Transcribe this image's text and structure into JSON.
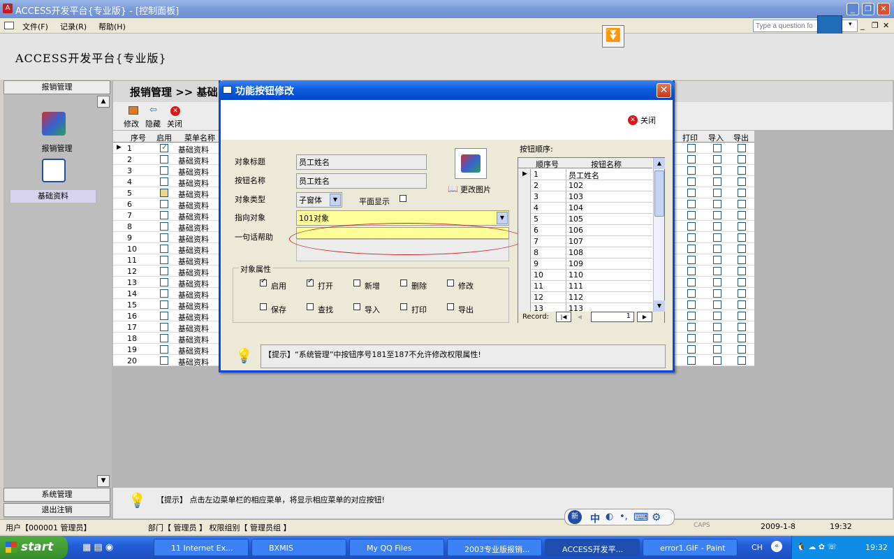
{
  "window": {
    "title": "ACCESS开发平台{专业版} - [控制面板]",
    "question_placeholder": "Type a question fo"
  },
  "menu": [
    "文件(F)",
    "记录(R)",
    "帮助(H)"
  ],
  "app_title": "ACCESS开发平台{专业版}",
  "sidebar": {
    "top_header": "报销管理",
    "items": [
      {
        "label": "报销管理",
        "icon": "cube-icon"
      },
      {
        "label": "基础资料",
        "icon": "dots-icon"
      }
    ],
    "bottom_items": [
      "系统管理",
      "退出注销"
    ]
  },
  "main": {
    "breadcrumb": "报销管理 >> 基础",
    "toolbar": [
      "修改",
      "隐藏",
      "关闭"
    ],
    "columns": [
      "序号",
      "启用",
      "菜单名称"
    ],
    "right_columns": [
      "打印",
      "导入",
      "导出"
    ],
    "rows": [
      {
        "no": "1",
        "enabled": true,
        "name": "基础资料"
      },
      {
        "no": "2",
        "enabled": false,
        "name": "基础资料"
      },
      {
        "no": "3",
        "enabled": false,
        "name": "基础资料"
      },
      {
        "no": "4",
        "enabled": false,
        "name": "基础资料"
      },
      {
        "no": "5",
        "enabled": false,
        "name": "基础资料"
      },
      {
        "no": "6",
        "enabled": false,
        "name": "基础资料"
      },
      {
        "no": "7",
        "enabled": false,
        "name": "基础资料"
      },
      {
        "no": "8",
        "enabled": false,
        "name": "基础资料"
      },
      {
        "no": "9",
        "enabled": false,
        "name": "基础资料"
      },
      {
        "no": "10",
        "enabled": false,
        "name": "基础资料"
      },
      {
        "no": "11",
        "enabled": false,
        "name": "基础资料"
      },
      {
        "no": "12",
        "enabled": false,
        "name": "基础资料"
      },
      {
        "no": "13",
        "enabled": false,
        "name": "基础资料"
      },
      {
        "no": "14",
        "enabled": false,
        "name": "基础资料"
      },
      {
        "no": "15",
        "enabled": false,
        "name": "基础资料"
      },
      {
        "no": "16",
        "enabled": false,
        "name": "基础资料"
      },
      {
        "no": "17",
        "enabled": false,
        "name": "基础资料"
      },
      {
        "no": "18",
        "enabled": false,
        "name": "基础资料"
      },
      {
        "no": "19",
        "enabled": false,
        "name": "基础资料"
      },
      {
        "no": "20",
        "enabled": false,
        "name": "基础资料"
      }
    ],
    "tip": "【提示】 点击左边菜单栏的相应菜单，将显示相应菜单的对应按钮!"
  },
  "dialog": {
    "title": "功能按钮修改",
    "close_label": "关闭",
    "fields": {
      "object_caption_label": "对象标题",
      "object_caption_value": "员工姓名",
      "button_name_label": "按钮名称",
      "button_name_value": "员工姓名",
      "object_type_label": "对象类型",
      "object_type_value": "子窗体",
      "flat_display_label": "平面显示",
      "target_label": "指向对象",
      "target_value": "101对象",
      "help_label": "一句话帮助",
      "help_value": ""
    },
    "change_picture": "更改图片",
    "attributes_title": "对象属性",
    "attributes": [
      {
        "label": "启用",
        "checked": true
      },
      {
        "label": "打开",
        "checked": true
      },
      {
        "label": "新增",
        "checked": false
      },
      {
        "label": "删除",
        "checked": false
      },
      {
        "label": "修改",
        "checked": false
      },
      {
        "label": "保存",
        "checked": false
      },
      {
        "label": "查找",
        "checked": false
      },
      {
        "label": "导入",
        "checked": false
      },
      {
        "label": "打印",
        "checked": false
      },
      {
        "label": "导出",
        "checked": false
      }
    ],
    "order_title": "按钮顺序:",
    "order_columns": [
      "顺序号",
      "按钮名称"
    ],
    "order_rows": [
      {
        "no": "1",
        "name": "员工姓名"
      },
      {
        "no": "2",
        "name": "102"
      },
      {
        "no": "3",
        "name": "103"
      },
      {
        "no": "4",
        "name": "104"
      },
      {
        "no": "5",
        "name": "105"
      },
      {
        "no": "6",
        "name": "106"
      },
      {
        "no": "7",
        "name": "107"
      },
      {
        "no": "8",
        "name": "108"
      },
      {
        "no": "9",
        "name": "109"
      },
      {
        "no": "10",
        "name": "110"
      },
      {
        "no": "11",
        "name": "111"
      },
      {
        "no": "12",
        "name": "112"
      },
      {
        "no": "13",
        "name": "113"
      }
    ],
    "record_label": "Record:",
    "record_value": "1",
    "tip": "【提示】“系统管理”中按钮序号181至187不允许修改权限属性!"
  },
  "status": {
    "user": "用户【000001 管理员】",
    "dept": "部门【 管理员 】 权限组别【 管理员组 】",
    "caps": "CAPS",
    "date": "2009-1-8",
    "time": "19:32"
  },
  "ime": [
    "中",
    "⌨"
  ],
  "taskbar": {
    "start": "start",
    "tasks": [
      "11 Internet Ex...",
      "BXMIS",
      "My QQ Files",
      "2003专业版报销...",
      "ACCESS开发平...",
      "error1.GIF - Paint"
    ],
    "lang": "CH",
    "clock": "19:32"
  },
  "colors": {
    "titlebar": "#0a5ee0",
    "highlight_field": "#ffff99",
    "annotation": "#cc2222"
  }
}
